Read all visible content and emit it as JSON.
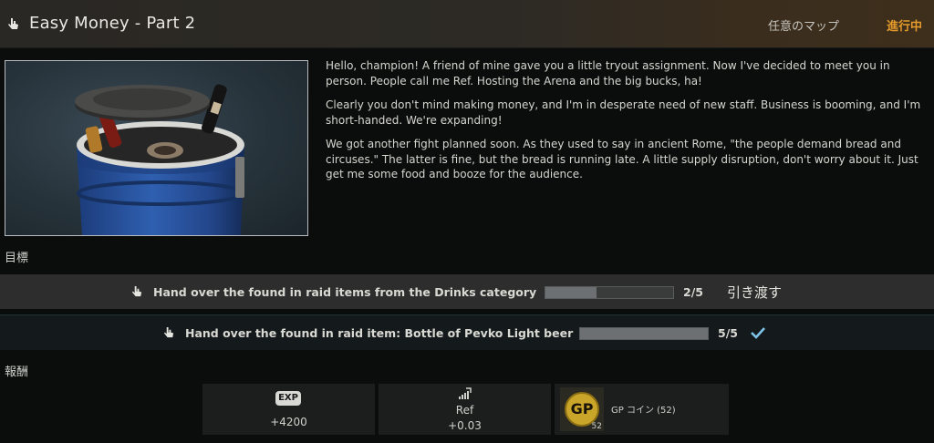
{
  "header": {
    "title": "Easy Money - Part 2",
    "map": "任意のマップ",
    "status": "進行中"
  },
  "description": [
    "Hello, champion! A friend of mine gave you a little tryout assignment. Now I've decided to meet you in person. People call me Ref. Hosting the Arena and the big bucks, ha!",
    "Clearly you don't mind making money, and I'm in desperate need of new staff. Business is booming, and I'm short-handed. We're expanding!",
    "We got another fight planned soon. As they used to say in ancient Rome, \"the people demand bread and circuses.\" The latter is fine, but the bread is running late. A little supply disruption, don't worry about it. Just get me some food and booze for the audience."
  ],
  "objectives_label": "目標",
  "objectives": [
    {
      "text": "Hand over the found in raid items from the Drinks category",
      "count": "2/5",
      "progress": 0.4,
      "action": "引き渡す"
    },
    {
      "text": "Hand over the found in raid item: Bottle of Pevko Light beer",
      "count": "5/5",
      "progress": 1.0
    }
  ],
  "rewards_label": "報酬",
  "rewards": {
    "exp": {
      "badge": "EXP",
      "value": "+4200"
    },
    "rep": {
      "name": "Ref",
      "value": "+0.03"
    },
    "item": {
      "badge": "GP",
      "corner": "52",
      "label": "GP コイン (52)"
    }
  },
  "colors": {
    "accent_status": "#e39a2a",
    "check": "#7ec3e8",
    "gp_coin": "#c9a52a"
  }
}
